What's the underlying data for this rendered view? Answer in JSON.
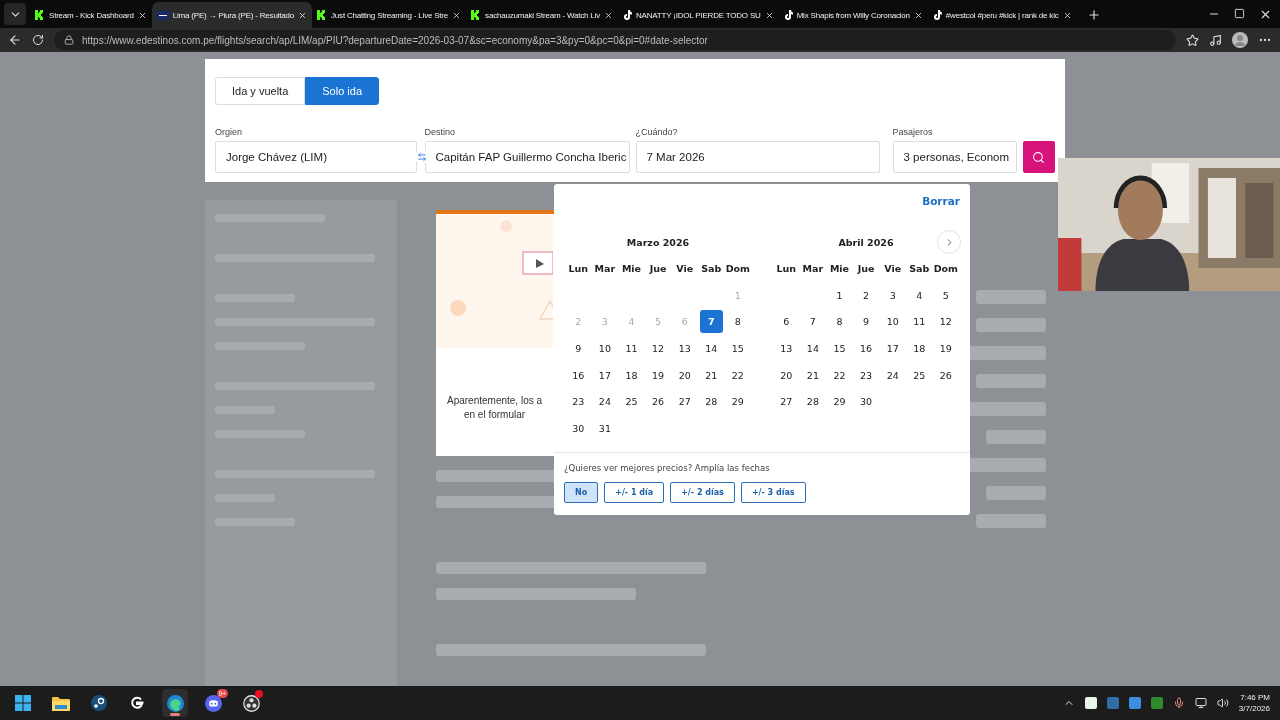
{
  "browser": {
    "tabs": [
      {
        "title": "Stream - Kick Dashboard",
        "kind": "kick",
        "selected": false
      },
      {
        "title": "Lima (PE) → Piura (PE) - Resultado",
        "kind": "edestinos",
        "selected": true
      },
      {
        "title": "Just Chatting Streaming - Live Stre",
        "kind": "kick",
        "selected": false
      },
      {
        "title": "sachauzumaki Stream - Watch Liv",
        "kind": "kick",
        "selected": false
      },
      {
        "title": "NANATTY ¡IDOL PIERDE TODO SU",
        "kind": "tiktok",
        "selected": false
      },
      {
        "title": "Mix Shapis from Willy Coronacion",
        "kind": "tiktok",
        "selected": false
      },
      {
        "title": "#westcol #peru #kick | rank de kic",
        "kind": "tiktok",
        "selected": false
      }
    ],
    "address": "https://www.edestinos.com.pe/flights/search/ap/LIM/ap/PIU?departureDate=2026-03-07&sc=economy&pa=3&py=0&pc=0&pi=0#date-selector"
  },
  "search_form": {
    "trip_types": [
      {
        "label": "Ida y vuelta",
        "selected": false
      },
      {
        "label": "Solo ida",
        "selected": true
      }
    ],
    "fields": [
      {
        "kind": "origin",
        "label": "Orgien",
        "value": "Jorge Chávez (LIM)"
      },
      {
        "kind": "destination",
        "label": "Destino",
        "value": "Capitán FAP Guillermo Concha Iberic"
      },
      {
        "kind": "date",
        "label": "¿Cuándo?",
        "value": "7 Mar 2026"
      },
      {
        "kind": "passengers",
        "label": "Pasajeros",
        "value": "3 personas, Econom"
      }
    ]
  },
  "results": {
    "message_lines": [
      "Aparentemente, los a",
      "en el formular"
    ]
  },
  "date_picker": {
    "clear": "Borrar",
    "months": [
      {
        "title": "Marzo 2026",
        "weekdays": [
          "Lun",
          "Mar",
          "Mie",
          "Jue",
          "Vie",
          "Sab",
          "Dom"
        ],
        "weeks": [
          [
            {
              "label": "1",
              "disabled": true,
              "selected": false
            }
          ],
          [
            {
              "label": "2",
              "disabled": true,
              "selected": false
            },
            {
              "label": "3",
              "disabled": true,
              "selected": false
            },
            {
              "label": "4",
              "disabled": true,
              "selected": false
            },
            {
              "label": "5",
              "disabled": true,
              "selected": false
            },
            {
              "label": "6",
              "disabled": true,
              "selected": false
            },
            {
              "label": "7",
              "disabled": false,
              "selected": true
            },
            {
              "label": "8",
              "disabled": false,
              "selected": false
            }
          ],
          [
            {
              "label": "9",
              "disabled": false,
              "selected": false
            },
            {
              "label": "10",
              "disabled": false,
              "selected": false
            },
            {
              "label": "11",
              "disabled": false,
              "selected": false
            },
            {
              "label": "12",
              "disabled": false,
              "selected": false
            },
            {
              "label": "13",
              "disabled": false,
              "selected": false
            },
            {
              "label": "14",
              "disabled": false,
              "selected": false
            },
            {
              "label": "15",
              "disabled": false,
              "selected": false
            }
          ],
          [
            {
              "label": "16",
              "disabled": false,
              "selected": false
            },
            {
              "label": "17",
              "disabled": false,
              "selected": false
            },
            {
              "label": "18",
              "disabled": false,
              "selected": false
            },
            {
              "label": "19",
              "disabled": false,
              "selected": false
            },
            {
              "label": "20",
              "disabled": false,
              "selected": false
            },
            {
              "label": "21",
              "disabled": false,
              "selected": false
            },
            {
              "label": "22",
              "disabled": false,
              "selected": false
            }
          ],
          [
            {
              "label": "23",
              "disabled": false,
              "selected": false
            },
            {
              "label": "24",
              "disabled": false,
              "selected": false
            },
            {
              "label": "25",
              "disabled": false,
              "selected": false
            },
            {
              "label": "26",
              "disabled": false,
              "selected": false
            },
            {
              "label": "27",
              "disabled": false,
              "selected": false
            },
            {
              "label": "28",
              "disabled": false,
              "selected": false
            },
            {
              "label": "29",
              "disabled": false,
              "selected": false
            }
          ],
          [
            {
              "label": "30",
              "disabled": false,
              "selected": false
            },
            {
              "label": "31",
              "disabled": false,
              "selected": false
            }
          ]
        ]
      },
      {
        "title": "Abril 2026",
        "weekdays": [
          "Lun",
          "Mar",
          "Mie",
          "Jue",
          "Vie",
          "Sab",
          "Dom"
        ],
        "weeks": [
          [
            {
              "label": "1",
              "disabled": false,
              "selected": false
            },
            {
              "label": "2",
              "disabled": false,
              "selected": false
            },
            {
              "label": "3",
              "disabled": false,
              "selected": false
            },
            {
              "label": "4",
              "disabled": false,
              "selected": false
            },
            {
              "label": "5",
              "disabled": false,
              "selected": false
            }
          ],
          [
            {
              "label": "6",
              "disabled": false,
              "selected": false
            },
            {
              "label": "7",
              "disabled": false,
              "selected": false
            },
            {
              "label": "8",
              "disabled": false,
              "selected": false
            },
            {
              "label": "9",
              "disabled": false,
              "selected": false
            },
            {
              "label": "10",
              "disabled": false,
              "selected": false
            },
            {
              "label": "11",
              "disabled": false,
              "selected": false
            },
            {
              "label": "12",
              "disabled": false,
              "selected": false
            }
          ],
          [
            {
              "label": "13",
              "disabled": false,
              "selected": false
            },
            {
              "label": "14",
              "disabled": false,
              "selected": false
            },
            {
              "label": "15",
              "disabled": false,
              "selected": false
            },
            {
              "label": "16",
              "disabled": false,
              "selected": false
            },
            {
              "label": "17",
              "disabled": false,
              "selected": false
            },
            {
              "label": "18",
              "disabled": false,
              "selected": false
            },
            {
              "label": "19",
              "disabled": false,
              "selected": false
            }
          ],
          [
            {
              "label": "20",
              "disabled": false,
              "selected": false
            },
            {
              "label": "21",
              "disabled": false,
              "selected": false
            },
            {
              "label": "22",
              "disabled": false,
              "selected": false
            },
            {
              "label": "23",
              "disabled": false,
              "selected": false
            },
            {
              "label": "24",
              "disabled": false,
              "selected": false
            },
            {
              "label": "25",
              "disabled": false,
              "selected": false
            },
            {
              "label": "26",
              "disabled": false,
              "selected": false
            }
          ],
          [
            {
              "label": "27",
              "disabled": false,
              "selected": false
            },
            {
              "label": "28",
              "disabled": false,
              "selected": false
            },
            {
              "label": "29",
              "disabled": false,
              "selected": false
            },
            {
              "label": "30",
              "disabled": false,
              "selected": false
            }
          ]
        ]
      }
    ],
    "flex_prompt": "¿Quieres ver mejores precios? Amplía las fechas",
    "flex_options": [
      {
        "label": "No",
        "selected": true
      },
      {
        "label": "+/- 1 día",
        "selected": false
      },
      {
        "label": "+/- 2 días",
        "selected": false
      },
      {
        "label": "+/- 3 días",
        "selected": false
      }
    ]
  },
  "taskbar": {
    "apps": [
      {
        "kind": "windows",
        "active": false,
        "alert": false
      },
      {
        "kind": "folder",
        "active": false,
        "alert": false
      },
      {
        "kind": "steam",
        "active": false,
        "alert": false
      },
      {
        "kind": "logitech",
        "active": false,
        "alert": false
      },
      {
        "kind": "edge",
        "active": true,
        "alert": false
      },
      {
        "kind": "discord",
        "active": false,
        "alert": false,
        "badge": "9+"
      },
      {
        "kind": "obs",
        "active": false,
        "alert": true
      }
    ],
    "clock": {
      "time": "7:46 PM",
      "date": "3/7/2026"
    }
  }
}
